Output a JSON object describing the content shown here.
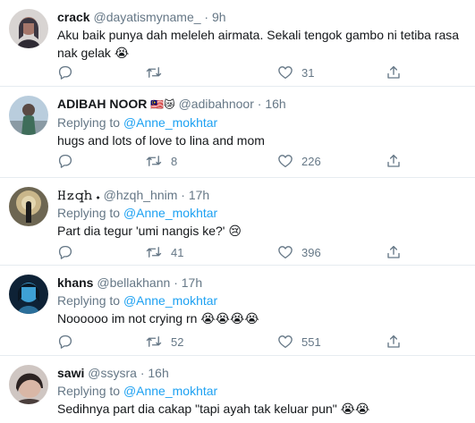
{
  "tweets": [
    {
      "name": "crack",
      "name_emoji": "",
      "handle": "@dayatismyname_",
      "time": "9h",
      "replying_label": "",
      "replying_to": "",
      "text": "Aku baik punya dah meleleh airmata. Sekali tengok gambo ni tetiba rasa nak gelak 😭",
      "replies": "",
      "retweets": "",
      "likes": "31"
    },
    {
      "name": "ADIBAH NOOR",
      "name_emoji": "🇲🇾😿",
      "handle": "@adibahnoor",
      "time": "16h",
      "replying_label": "Replying to",
      "replying_to": "@Anne_mokhtar",
      "text": "hugs and lots of love to lina and mom",
      "replies": "",
      "retweets": "8",
      "likes": "226"
    },
    {
      "name": "𝙷𝚣𝚚𝚑 𝆺",
      "name_emoji": "",
      "handle": "@hzqh_hnim",
      "time": "17h",
      "replying_label": "Replying to",
      "replying_to": "@Anne_mokhtar",
      "text": "Part dia tegur 'umi nangis ke?' 😢",
      "replies": "",
      "retweets": "41",
      "likes": "396"
    },
    {
      "name": "khans",
      "name_emoji": "",
      "handle": "@bellakhann",
      "time": "17h",
      "replying_label": "Replying to",
      "replying_to": "@Anne_mokhtar",
      "text": "Noooooo im not crying rn 😭😭😭😭",
      "replies": "",
      "retweets": "52",
      "likes": "551"
    },
    {
      "name": "sawi",
      "name_emoji": "",
      "handle": "@ssysra",
      "time": "16h",
      "replying_label": "Replying to",
      "replying_to": "@Anne_mokhtar",
      "text": "Sedihnya part dia cakap \"tapi ayah tak keluar pun\" 😭😭",
      "replies": "",
      "retweets": "",
      "likes": ""
    }
  ],
  "separator": "·",
  "colors": {
    "text": "#14171a",
    "muted": "#657786",
    "link": "#1da1f2",
    "border": "#e6ecf0"
  },
  "icons": [
    "reply-icon",
    "retweet-icon",
    "like-icon",
    "share-icon"
  ]
}
